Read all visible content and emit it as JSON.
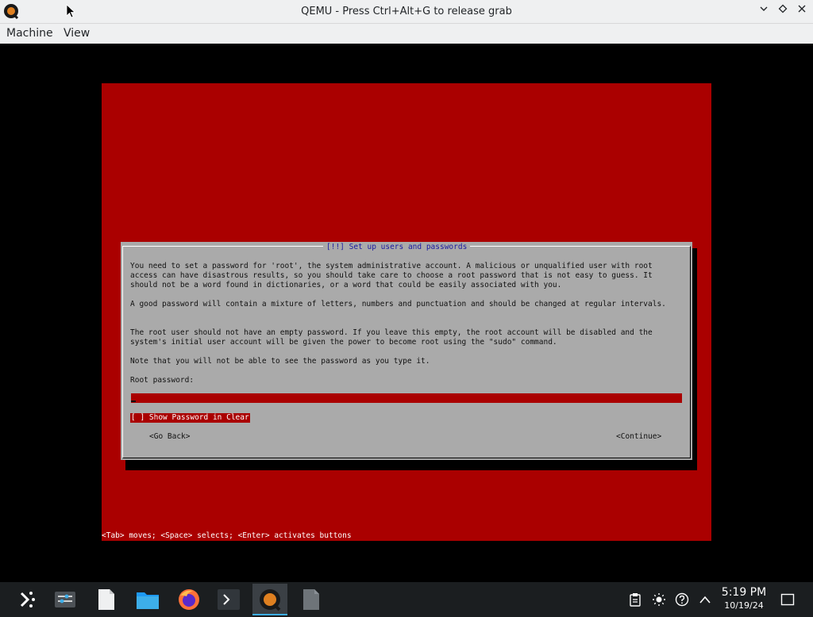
{
  "window": {
    "title": "QEMU - Press Ctrl+Alt+G to release grab",
    "controls": [
      "minimize",
      "maximize",
      "close"
    ]
  },
  "menu": {
    "items": [
      "Machine",
      "View"
    ]
  },
  "installer": {
    "dialog_title": "[!!] Set up users and passwords",
    "paragraphs": [
      "You need to set a password for 'root', the system administrative account. A malicious or unqualified user with root access can have disastrous results, so you should take care to choose a root password that is not easy to guess. It should not be a word found in dictionaries, or a word that could be easily associated with you.",
      "A good password will contain a mixture of letters, numbers and punctuation and should be changed at regular intervals.",
      "The root user should not have an empty password. If you leave this empty, the root account will be disabled and the system's initial user account will be given the power to become root using the \"sudo\" command.",
      "Note that you will not be able to see the password as you type it."
    ],
    "field_label": "Root password:",
    "field_value": "",
    "show_password_label": "[ ] Show Password in Clear",
    "back_button": "<Go Back>",
    "continue_button": "<Continue>",
    "help_line": "<Tab> moves; <Space> selects; <Enter> activates buttons"
  },
  "taskbar": {
    "apps": [
      "app-launcher",
      "system-settings",
      "text-file",
      "file-manager",
      "firefox",
      "terminal",
      "qemu",
      "document"
    ],
    "active_app": "qemu",
    "tray": [
      "clipboard",
      "brightness",
      "help",
      "expand"
    ],
    "clock_time": "5:19 PM",
    "clock_date": "10/19/24"
  },
  "colors": {
    "installer_background": "#aa0000",
    "dialog_background": "#aaaaaa",
    "dialog_title": "#1a1aa0",
    "taskbar": "#1b1e20",
    "active_indicator": "#3daee9"
  }
}
